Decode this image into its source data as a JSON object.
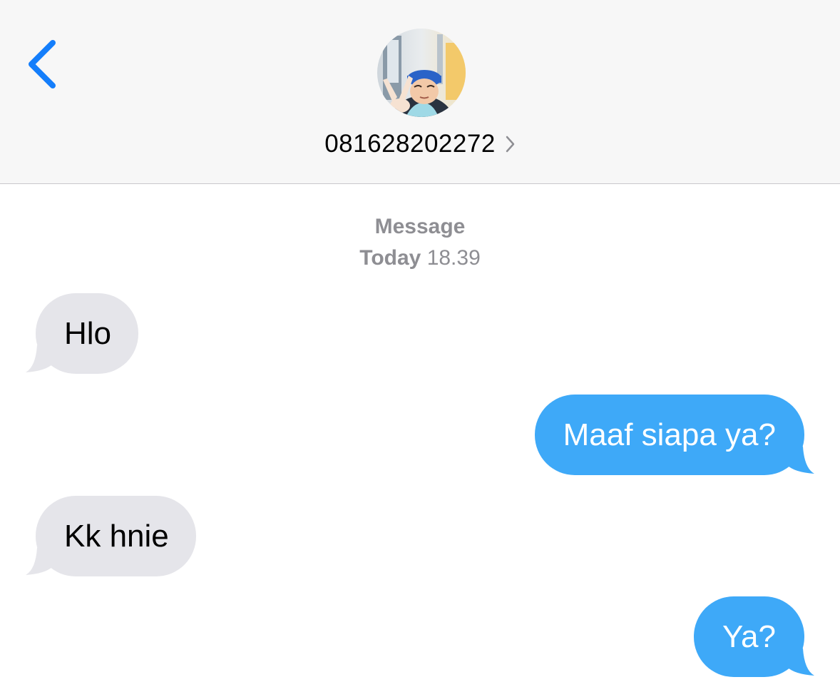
{
  "header": {
    "back_icon": "chevron-left-icon",
    "contact_name": "081628202272",
    "chevron_icon": "chevron-right-icon",
    "avatar_icon": "contact-photo"
  },
  "thread": {
    "service": "Message",
    "day": "Today",
    "time": "18.39"
  },
  "messages": [
    {
      "direction": "incoming",
      "text": "Hlo"
    },
    {
      "direction": "outgoing",
      "text": "Maaf siapa ya?"
    },
    {
      "direction": "incoming",
      "text": "Kk hnie"
    },
    {
      "direction": "outgoing",
      "text": "Ya?"
    }
  ],
  "colors": {
    "accent": "#147efb",
    "outgoing_bubble": "#3ea9f8",
    "incoming_bubble": "#e5e5ea",
    "header_bg": "#f7f7f7",
    "meta_text": "#8e8e93"
  }
}
